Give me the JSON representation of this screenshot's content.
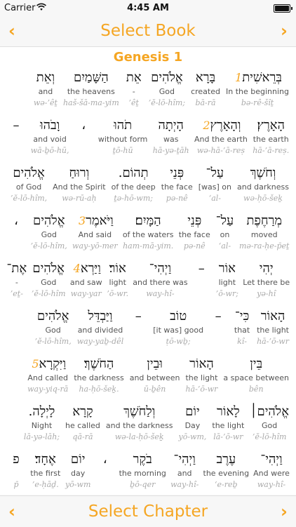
{
  "status": {
    "carrier": "Carrier",
    "time": "4:45 AM",
    "battery_level": 1.0
  },
  "top_nav": {
    "title": "Select Book",
    "back_icon": "chevron-left-icon",
    "forward_icon": "chevron-right-icon"
  },
  "bottom_nav": {
    "title": "Select Chapter",
    "back_icon": "chevron-left-icon",
    "forward_icon": "chevron-right-icon"
  },
  "colors": {
    "accent": "#f5a623",
    "translit": "#aaaaaa",
    "english": "#555555",
    "hebrew": "#111111"
  },
  "chapter": {
    "heading": "Genesis 1",
    "lines": [
      [
        {
          "verse": "1",
          "heb": "בְּרֵאשִׁית",
          "eng": "In the beginning",
          "tr": "bə-rê-šîṯ"
        },
        {
          "heb": "בָּרָא",
          "eng": "created",
          "tr": "bā-rā"
        },
        {
          "heb": "אֱלֹהִים",
          "eng": "God",
          "tr": "’ĕ-lō-hîm;"
        },
        {
          "heb": "אֵת",
          "eng": "-",
          "tr": "’êṯ"
        },
        {
          "heb": "הַשָּׁמַיִם",
          "eng": "the heavens",
          "tr": "haš-šā-ma-yim"
        },
        {
          "heb": "וְאֵת",
          "eng": "and",
          "tr": "wə-’êṯ"
        }
      ],
      [
        {
          "heb": "הָאָרֶץ׃",
          "eng": "the earth",
          "tr": "hā-’ā-reṣ."
        },
        {
          "verse": "2",
          "heb": "וְהָאָרֶץ",
          "eng": "And the earth",
          "tr": "wə-hā-’ā-reṣ"
        },
        {
          "heb": "הָיְתָה",
          "eng": "was",
          "tr": "hā-yə-ṯāh"
        },
        {
          "heb": "תֹהוּ",
          "eng": "without form",
          "tr": "ṯō-hū"
        },
        {
          "heb": "،",
          "eng": "",
          "tr": ""
        },
        {
          "heb": "וָבֹהוּ",
          "eng": "and void",
          "tr": "wā-ḇō-hū,"
        },
        {
          "heb": "–",
          "eng": "",
          "tr": ""
        }
      ],
      [
        {
          "heb": "וְחֹשֶׁךְ",
          "eng": "and darkness",
          "tr": "wə-ḥō-šeḵ"
        },
        {
          "heb": "עַל־",
          "eng": "[was] on",
          "tr": "‘al-"
        },
        {
          "heb": "פְּנֵי",
          "eng": "the face",
          "tr": "pə-nê"
        },
        {
          "heb": "תְהוֹם.",
          "eng": "of the deep",
          "tr": "ṯə-hō-wm;"
        },
        {
          "heb": "וְרוּחַ",
          "eng": "And the Spirit",
          "tr": "wə-rū-aḥ"
        },
        {
          "heb": "אֱלֹהִים",
          "eng": "of God",
          "tr": "’ĕ-lō-hîm,"
        }
      ],
      [
        {
          "heb": "מְרַחֶפֶת",
          "eng": "moved",
          "tr": "mə-ra-ḥe-p̄eṯ"
        },
        {
          "heb": "עַל־",
          "eng": "on",
          "tr": "‘al-"
        },
        {
          "heb": "פְּנֵי",
          "eng": "the face",
          "tr": "pə-nê"
        },
        {
          "heb": "הַמָּיִם׃",
          "eng": "of the waters",
          "tr": "ham-mā-yim."
        },
        {
          "verse": "3",
          "heb": "וַיֹּאמֶר",
          "eng": "And said",
          "tr": "way-yō-mer"
        },
        {
          "heb": "אֱלֹהִים",
          "eng": "God",
          "tr": "’ĕ-lō-hîm,"
        },
        {
          "heb": "،",
          "eng": "",
          "tr": ""
        }
      ],
      [
        {
          "heb": "יְהִי",
          "eng": "Let there be",
          "tr": "yə-hî"
        },
        {
          "heb": "אוֹר",
          "eng": "light",
          "tr": "’ō-wr;"
        },
        {
          "heb": "–",
          "eng": "",
          "tr": ""
        },
        {
          "heb": "וַיְהִי־",
          "eng": "and there was",
          "tr": "way-hî-"
        },
        {
          "heb": "אוֹר׃",
          "eng": "light",
          "tr": "’ō-wr."
        },
        {
          "verse": "4",
          "heb": "וַיַּרְא",
          "eng": "and saw",
          "tr": "way-yar"
        },
        {
          "heb": "אֱלֹהִים",
          "eng": "God",
          "tr": "’ĕ-lō-hîm"
        },
        {
          "heb": "אֶת־",
          "eng": "-",
          "tr": "’eṯ-"
        }
      ],
      [
        {
          "heb": "הָאוֹר",
          "eng": "the light",
          "tr": "hā-’ō-wr"
        },
        {
          "heb": "כִּי־",
          "eng": "that",
          "tr": "kî-"
        },
        {
          "heb": "–",
          "eng": "",
          "tr": ""
        },
        {
          "heb": "טוֹב",
          "eng": "[it was] good",
          "tr": "ṭō-wḇ;"
        },
        {
          "heb": "–",
          "eng": "",
          "tr": ""
        },
        {
          "heb": "וַיַּבְדֵּל",
          "eng": "and divided",
          "tr": "way-yaḇ-dêl"
        },
        {
          "heb": "אֱלֹהִים",
          "eng": "God",
          "tr": "’ĕ-lō-hîm,"
        }
      ],
      [
        {
          "heb": "בֵּין",
          "eng": "a space between",
          "tr": "bên"
        },
        {
          "heb": "הָאוֹר",
          "eng": "the light",
          "tr": "hā-’ō-wr"
        },
        {
          "heb": "וּבֵין",
          "eng": "and between",
          "tr": "ū-ḇên"
        },
        {
          "heb": "הַחֹשֶׁךְ׃",
          "eng": "the darkness",
          "tr": "ha-ḥō-šeḵ."
        },
        {
          "verse": "5",
          "heb": "וַיִּקְרָא",
          "eng": "And called",
          "tr": "way-yiq-rā"
        }
      ],
      [
        {
          "heb": "אֱלֹהִים׀",
          "eng": "God",
          "tr": "’ĕ-lō-hîm"
        },
        {
          "heb": "לָאוֹר",
          "eng": "the light",
          "tr": "lā-’ō-wr"
        },
        {
          "heb": "יוֹם",
          "eng": "Day",
          "tr": "yō-wm,"
        },
        {
          "heb": "וְלַחֹשֶׁךְ",
          "eng": "and the darkness",
          "tr": "wə-la-ḥō-šeḵ"
        },
        {
          "heb": "קָרָא",
          "eng": "he called",
          "tr": "qā-rā"
        },
        {
          "heb": "לָיְלָה.",
          "eng": "Night",
          "tr": "lā-yə-lāh;"
        }
      ],
      [
        {
          "heb": "וַיְהִי־",
          "eng": "And were",
          "tr": "way-hî-"
        },
        {
          "heb": "עֶרֶב",
          "eng": "the evening",
          "tr": "‘e-reḇ"
        },
        {
          "heb": "וַיְהִי־",
          "eng": "and",
          "tr": "way-hî-"
        },
        {
          "heb": "בֹקֶר",
          "eng": "the morning",
          "tr": "ḇō-qer"
        },
        {
          "heb": "،",
          "eng": "",
          "tr": ""
        },
        {
          "heb": "יוֹם",
          "eng": "day",
          "tr": "yō-wm"
        },
        {
          "heb": "אֶחָד׃",
          "eng": "the first",
          "tr": "’e-ḥāḏ."
        },
        {
          "heb": "פ",
          "eng": "",
          "tr": "p̄"
        }
      ]
    ]
  }
}
